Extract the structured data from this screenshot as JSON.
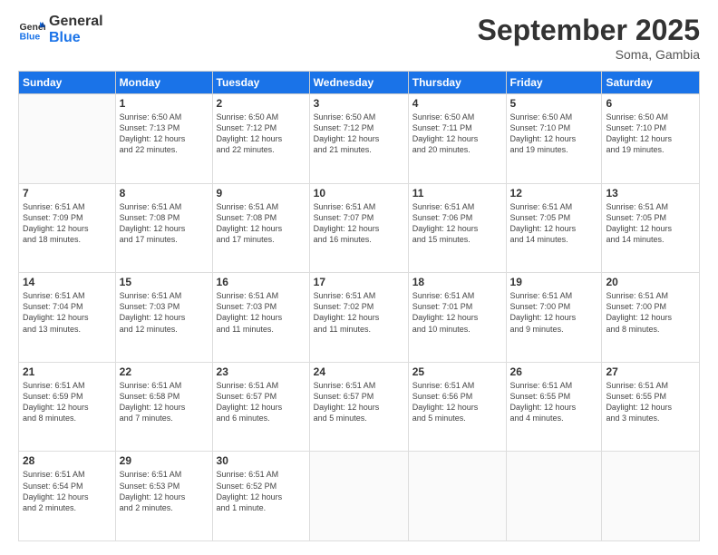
{
  "logo": {
    "line1": "General",
    "line2": "Blue"
  },
  "title": "September 2025",
  "subtitle": "Soma, Gambia",
  "days_header": [
    "Sunday",
    "Monday",
    "Tuesday",
    "Wednesday",
    "Thursday",
    "Friday",
    "Saturday"
  ],
  "weeks": [
    [
      {
        "day": "",
        "info": ""
      },
      {
        "day": "1",
        "info": "Sunrise: 6:50 AM\nSunset: 7:13 PM\nDaylight: 12 hours\nand 22 minutes."
      },
      {
        "day": "2",
        "info": "Sunrise: 6:50 AM\nSunset: 7:12 PM\nDaylight: 12 hours\nand 22 minutes."
      },
      {
        "day": "3",
        "info": "Sunrise: 6:50 AM\nSunset: 7:12 PM\nDaylight: 12 hours\nand 21 minutes."
      },
      {
        "day": "4",
        "info": "Sunrise: 6:50 AM\nSunset: 7:11 PM\nDaylight: 12 hours\nand 20 minutes."
      },
      {
        "day": "5",
        "info": "Sunrise: 6:50 AM\nSunset: 7:10 PM\nDaylight: 12 hours\nand 19 minutes."
      },
      {
        "day": "6",
        "info": "Sunrise: 6:50 AM\nSunset: 7:10 PM\nDaylight: 12 hours\nand 19 minutes."
      }
    ],
    [
      {
        "day": "7",
        "info": "Sunrise: 6:51 AM\nSunset: 7:09 PM\nDaylight: 12 hours\nand 18 minutes."
      },
      {
        "day": "8",
        "info": "Sunrise: 6:51 AM\nSunset: 7:08 PM\nDaylight: 12 hours\nand 17 minutes."
      },
      {
        "day": "9",
        "info": "Sunrise: 6:51 AM\nSunset: 7:08 PM\nDaylight: 12 hours\nand 17 minutes."
      },
      {
        "day": "10",
        "info": "Sunrise: 6:51 AM\nSunset: 7:07 PM\nDaylight: 12 hours\nand 16 minutes."
      },
      {
        "day": "11",
        "info": "Sunrise: 6:51 AM\nSunset: 7:06 PM\nDaylight: 12 hours\nand 15 minutes."
      },
      {
        "day": "12",
        "info": "Sunrise: 6:51 AM\nSunset: 7:05 PM\nDaylight: 12 hours\nand 14 minutes."
      },
      {
        "day": "13",
        "info": "Sunrise: 6:51 AM\nSunset: 7:05 PM\nDaylight: 12 hours\nand 14 minutes."
      }
    ],
    [
      {
        "day": "14",
        "info": "Sunrise: 6:51 AM\nSunset: 7:04 PM\nDaylight: 12 hours\nand 13 minutes."
      },
      {
        "day": "15",
        "info": "Sunrise: 6:51 AM\nSunset: 7:03 PM\nDaylight: 12 hours\nand 12 minutes."
      },
      {
        "day": "16",
        "info": "Sunrise: 6:51 AM\nSunset: 7:03 PM\nDaylight: 12 hours\nand 11 minutes."
      },
      {
        "day": "17",
        "info": "Sunrise: 6:51 AM\nSunset: 7:02 PM\nDaylight: 12 hours\nand 11 minutes."
      },
      {
        "day": "18",
        "info": "Sunrise: 6:51 AM\nSunset: 7:01 PM\nDaylight: 12 hours\nand 10 minutes."
      },
      {
        "day": "19",
        "info": "Sunrise: 6:51 AM\nSunset: 7:00 PM\nDaylight: 12 hours\nand 9 minutes."
      },
      {
        "day": "20",
        "info": "Sunrise: 6:51 AM\nSunset: 7:00 PM\nDaylight: 12 hours\nand 8 minutes."
      }
    ],
    [
      {
        "day": "21",
        "info": "Sunrise: 6:51 AM\nSunset: 6:59 PM\nDaylight: 12 hours\nand 8 minutes."
      },
      {
        "day": "22",
        "info": "Sunrise: 6:51 AM\nSunset: 6:58 PM\nDaylight: 12 hours\nand 7 minutes."
      },
      {
        "day": "23",
        "info": "Sunrise: 6:51 AM\nSunset: 6:57 PM\nDaylight: 12 hours\nand 6 minutes."
      },
      {
        "day": "24",
        "info": "Sunrise: 6:51 AM\nSunset: 6:57 PM\nDaylight: 12 hours\nand 5 minutes."
      },
      {
        "day": "25",
        "info": "Sunrise: 6:51 AM\nSunset: 6:56 PM\nDaylight: 12 hours\nand 5 minutes."
      },
      {
        "day": "26",
        "info": "Sunrise: 6:51 AM\nSunset: 6:55 PM\nDaylight: 12 hours\nand 4 minutes."
      },
      {
        "day": "27",
        "info": "Sunrise: 6:51 AM\nSunset: 6:55 PM\nDaylight: 12 hours\nand 3 minutes."
      }
    ],
    [
      {
        "day": "28",
        "info": "Sunrise: 6:51 AM\nSunset: 6:54 PM\nDaylight: 12 hours\nand 2 minutes."
      },
      {
        "day": "29",
        "info": "Sunrise: 6:51 AM\nSunset: 6:53 PM\nDaylight: 12 hours\nand 2 minutes."
      },
      {
        "day": "30",
        "info": "Sunrise: 6:51 AM\nSunset: 6:52 PM\nDaylight: 12 hours\nand 1 minute."
      },
      {
        "day": "",
        "info": ""
      },
      {
        "day": "",
        "info": ""
      },
      {
        "day": "",
        "info": ""
      },
      {
        "day": "",
        "info": ""
      }
    ]
  ]
}
